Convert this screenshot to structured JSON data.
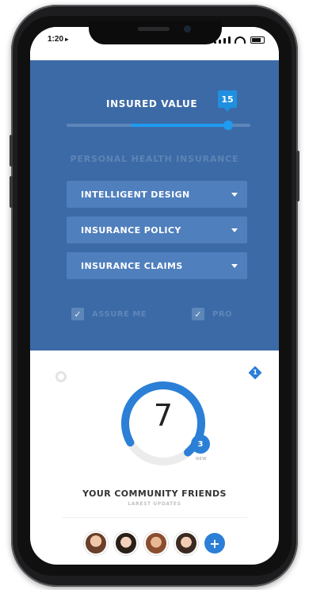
{
  "status_bar": {
    "time": "1:20"
  },
  "insured": {
    "label": "INSURED VALUE",
    "value": "15",
    "slider_fraction": 0.88
  },
  "section_label": "PERSONAL HEALTH INSURANCE",
  "dropdowns": [
    {
      "label": "INTELLIGENT DESIGN"
    },
    {
      "label": "INSURANCE POLICY"
    },
    {
      "label": "INSURANCE CLAIMS"
    }
  ],
  "checkboxes": [
    {
      "label": "ASSURE ME",
      "checked": true
    },
    {
      "label": "PRO",
      "checked": true
    }
  ],
  "community": {
    "top_badge": "1",
    "count": "7",
    "small_badge": "3",
    "small_badge_caption": "NEW",
    "title": "YOUR COMMUNITY FRIENDS",
    "subtitle": "LAREST UPDATES",
    "gauge_fraction": 0.72
  },
  "avatars": [
    {
      "icon": "avatar-face-1"
    },
    {
      "icon": "avatar-face-2"
    },
    {
      "icon": "avatar-face-3"
    },
    {
      "icon": "avatar-face-4"
    }
  ],
  "add_button": {
    "icon": "plus-icon",
    "label": "+"
  },
  "colors": {
    "primary_blue": "#3c6aa6",
    "accent_blue": "#2b7fd6",
    "light_blue": "#1f9bf0",
    "text_dark": "#333333"
  }
}
